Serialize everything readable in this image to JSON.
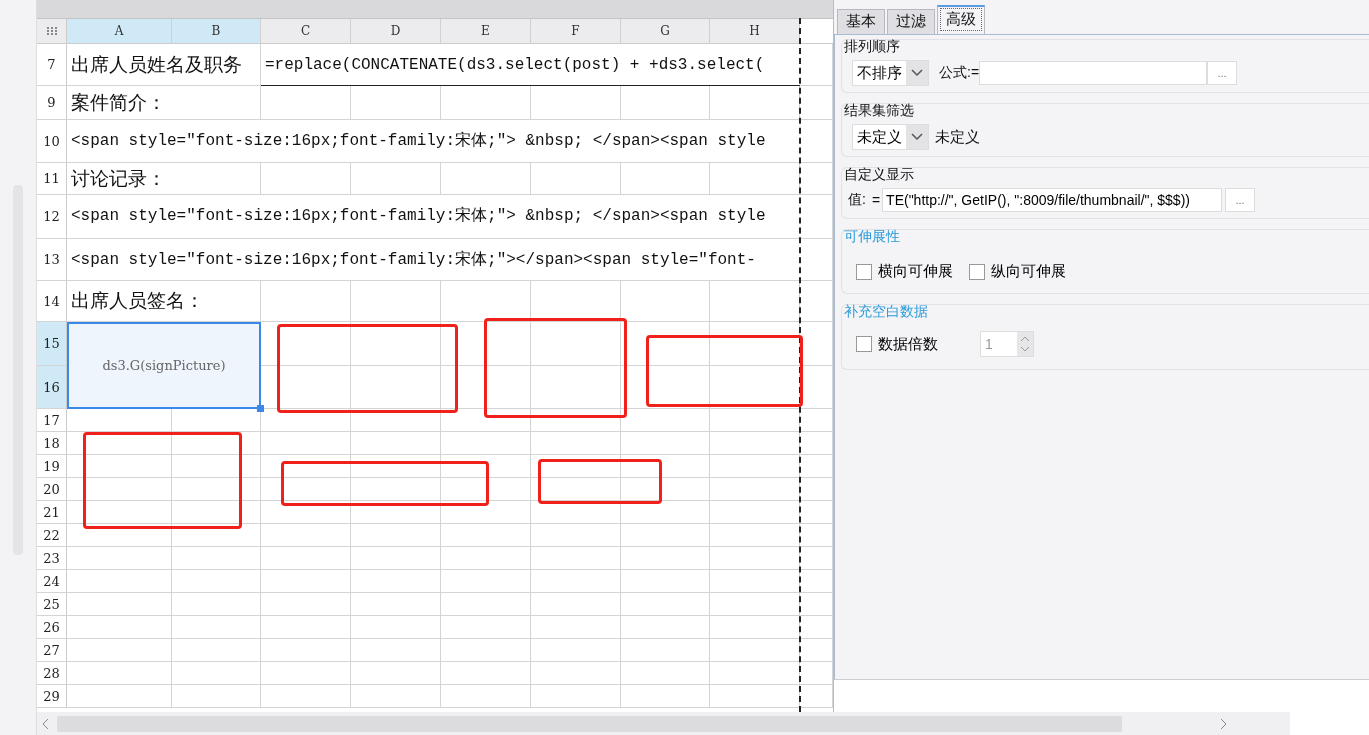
{
  "sheet": {
    "columns": [
      {
        "label": "A",
        "selected": true
      },
      {
        "label": "B",
        "selected": true
      },
      {
        "label": "C",
        "selected": false
      },
      {
        "label": "D",
        "selected": false
      },
      {
        "label": "E",
        "selected": false
      },
      {
        "label": "F",
        "selected": false
      },
      {
        "label": "G",
        "selected": false
      },
      {
        "label": "H",
        "selected": false
      }
    ],
    "rows": [
      {
        "number": "7",
        "selected": false,
        "cells": [
          {
            "kind": "label",
            "text": "出席人员姓名及职务",
            "colspan": 2
          },
          {
            "kind": "formula",
            "text": "=replace(CONCATENATE(ds3.select(post) + +ds3.select(",
            "colspan": 6
          }
        ]
      },
      {
        "number": "9",
        "selected": false,
        "cells": [
          {
            "kind": "label",
            "text": "案件简介：",
            "colspan": 2
          }
        ]
      },
      {
        "number": "10",
        "selected": false,
        "cells": [
          {
            "kind": "formula",
            "text": "<span style=\"font-size:16px;font-family:宋体;\"> &nbsp; </span><span style",
            "colspan": 8
          }
        ]
      },
      {
        "number": "11",
        "selected": false,
        "cells": [
          {
            "kind": "label",
            "text": "讨论记录：",
            "colspan": 2
          }
        ]
      },
      {
        "number": "12",
        "selected": false,
        "cells": [
          {
            "kind": "formula",
            "text": "<span style=\"font-size:16px;font-family:宋体;\"> &nbsp; </span><span style",
            "colspan": 8
          }
        ]
      },
      {
        "number": "13",
        "selected": false,
        "cells": [
          {
            "kind": "formula",
            "text": "<span style=\"font-size:16px;font-family:宋体;\"></span><span style=\"font-",
            "colspan": 8
          }
        ]
      },
      {
        "number": "14",
        "selected": false,
        "cells": [
          {
            "kind": "label",
            "text": "出席人员签名：",
            "colspan": 2
          }
        ]
      },
      {
        "number": "15",
        "selected": true,
        "cells": [
          {
            "kind": "picture",
            "text": "ds3.G(signPicture)",
            "selected": true,
            "colspan": 2,
            "rowspan": 2
          }
        ]
      },
      {
        "number": "16",
        "selected": true,
        "cells": []
      },
      {
        "number": "17",
        "selected": false,
        "cells": []
      },
      {
        "number": "18",
        "selected": false,
        "cells": []
      },
      {
        "number": "19",
        "selected": false,
        "cells": []
      },
      {
        "number": "20",
        "selected": false,
        "cells": []
      },
      {
        "number": "21",
        "selected": false,
        "cells": []
      },
      {
        "number": "22",
        "selected": false,
        "cells": []
      },
      {
        "number": "23",
        "selected": false,
        "cells": []
      },
      {
        "number": "24",
        "selected": false,
        "cells": []
      },
      {
        "number": "25",
        "selected": false,
        "cells": []
      },
      {
        "number": "26",
        "selected": false,
        "cells": []
      },
      {
        "number": "27",
        "selected": false,
        "cells": []
      },
      {
        "number": "28",
        "selected": false,
        "cells": []
      },
      {
        "number": "29",
        "selected": false,
        "cells": []
      }
    ]
  },
  "panel": {
    "tabs": [
      {
        "label": "基本",
        "selected": false
      },
      {
        "label": "过滤",
        "selected": false
      },
      {
        "label": "高级",
        "selected": true
      }
    ],
    "sort": {
      "title": "排列顺序",
      "dropdown": "不排序",
      "formula_label": "公式:=",
      "more_button": "..."
    },
    "filter": {
      "title": "结果集筛选",
      "dropdown": "未定义",
      "note": "未定义"
    },
    "custom_display": {
      "title": "自定义显示",
      "value_label": "值:",
      "equals": "=",
      "value": "TE(\"http://\", GetIP(), \":8009/file/thumbnail/\", $$$))",
      "more_button": "..."
    },
    "stretch": {
      "title": "可伸展性",
      "options": [
        {
          "label": "横向可伸展",
          "checked": false
        },
        {
          "label": "纵向可伸展",
          "checked": false
        }
      ]
    },
    "fill_blank": {
      "title": "补充空白数据",
      "option": {
        "label": "数据倍数",
        "checked": false
      },
      "multiplier": "1"
    }
  }
}
